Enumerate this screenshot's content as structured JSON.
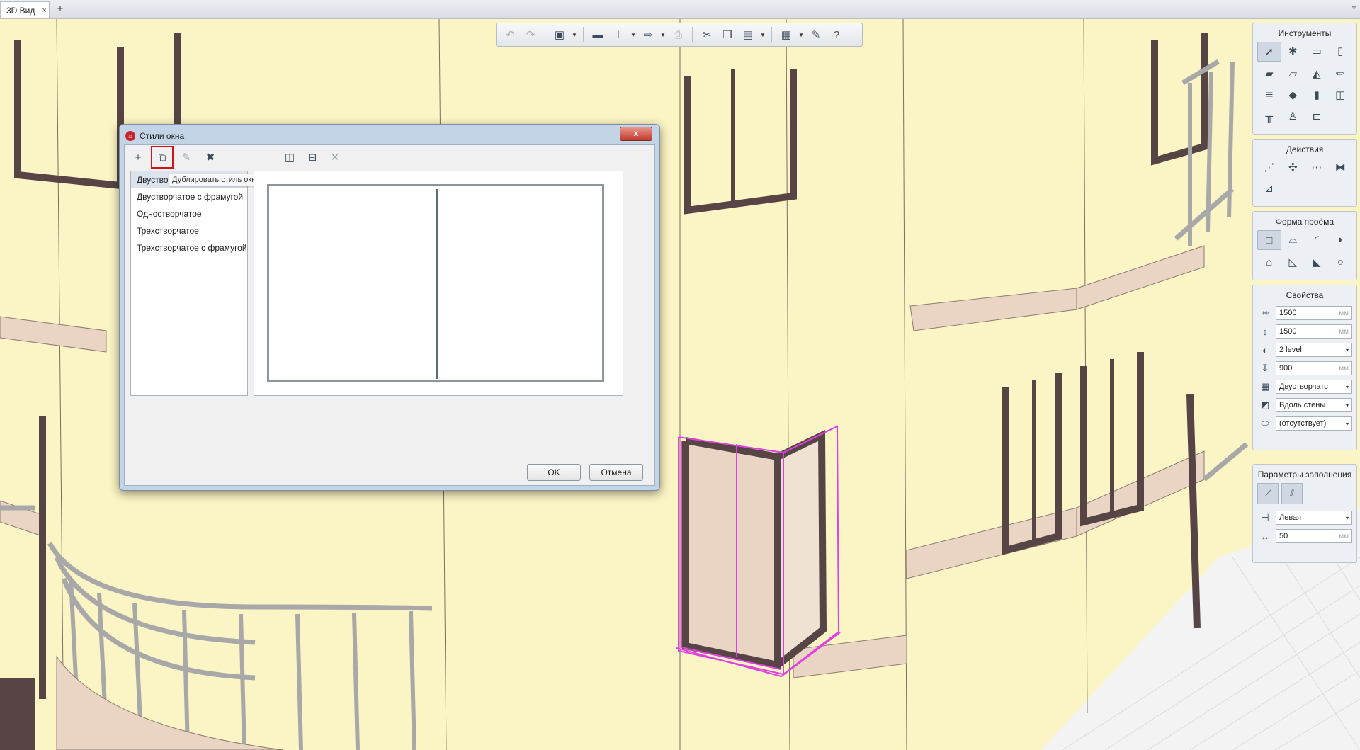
{
  "tabbar": {
    "tab_label": "3D Вид",
    "close_glyph": "×",
    "add_glyph": "+",
    "menu_glyph": "▿"
  },
  "toolbar": {
    "icons": [
      "undo-icon",
      "redo-icon",
      "view-cube-icon",
      "folder-icon",
      "level-icon",
      "export-icon",
      "print-icon",
      "cut-icon",
      "copy-icon",
      "paste-icon",
      "grid-icon",
      "wrench-icon",
      "help-icon"
    ]
  },
  "panels": {
    "tools": {
      "title": "Инструменты",
      "icons": [
        "cursor-icon",
        "compass-icon",
        "wall-icon",
        "column-icon",
        "slab-icon",
        "beam-icon",
        "roof-icon",
        "pencil-icon",
        "stair-icon",
        "floor-icon",
        "door-icon",
        "window-icon",
        "railing-icon",
        "toilet-icon",
        "opening-icon"
      ]
    },
    "actions": {
      "title": "Действия",
      "icons": [
        "move-icon",
        "rotate-icon",
        "array-icon",
        "mirror-icon",
        "trim-icon"
      ]
    },
    "opening_shape": {
      "title": "Форма проёма"
    },
    "properties": {
      "title": "Свойства",
      "width": "1500",
      "height": "1500",
      "level": "2 level",
      "sill": "900",
      "style": "Двустворчатс",
      "orientation": "Вдоль стены",
      "marker": "(отсутствует)",
      "unit": "мм",
      "dropdown_arrow": "▾"
    },
    "fill": {
      "title": "Параметры заполнения",
      "side": "Левая",
      "offset": "50",
      "unit": "мм"
    }
  },
  "dialog": {
    "title": "Стили окна",
    "close": "x",
    "tooltip": "Дублировать стиль окна",
    "styles": [
      "Двустворчатое",
      "Двустворчатое с фрамугой",
      "Одностворчатое",
      "Трехстворчатое",
      "Трехстворчатое с фрамугой"
    ],
    "selected_index": 0,
    "ok": "OK",
    "cancel": "Отмена"
  },
  "colors": {
    "wall": "#fbf4c4",
    "frame": "#574545",
    "slab": "#ead5c5",
    "selection": "#e040e0",
    "railing": "#a8a8a8"
  }
}
